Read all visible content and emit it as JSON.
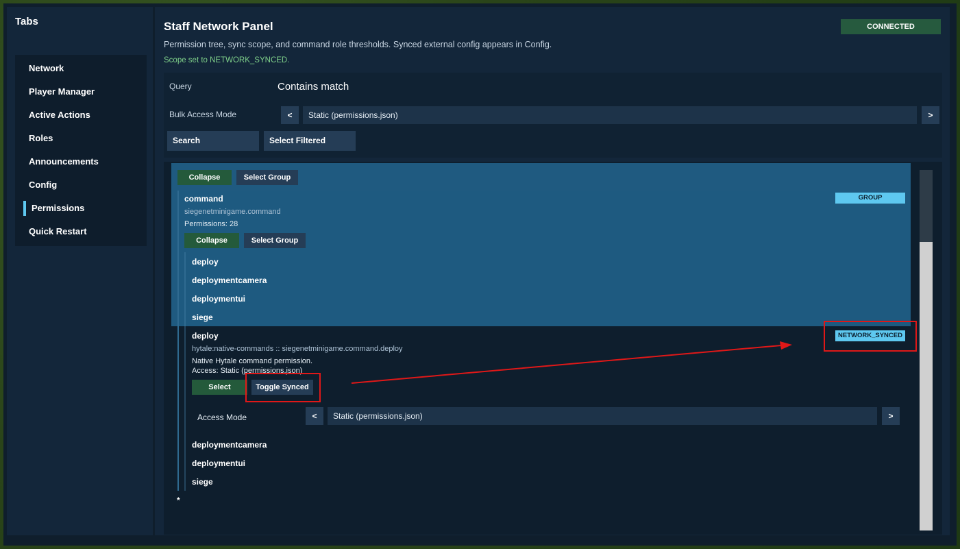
{
  "sidebar": {
    "title": "Tabs",
    "items": [
      {
        "label": "Network"
      },
      {
        "label": "Player Manager"
      },
      {
        "label": "Active Actions"
      },
      {
        "label": "Roles"
      },
      {
        "label": "Announcements"
      },
      {
        "label": "Config"
      },
      {
        "label": "Permissions",
        "active": true
      },
      {
        "label": "Quick Restart"
      }
    ]
  },
  "header": {
    "title": "Staff Network Panel",
    "status": "CONNECTED",
    "description": "Permission tree, sync scope, and command role thresholds. Synced external config appears in Config.",
    "scope_message": "Scope set to NETWORK_SYNCED."
  },
  "filters": {
    "query_label": "Query",
    "query_value": "Contains match",
    "bulk_label": "Bulk Access Mode",
    "prev": "<",
    "next": ">",
    "bulk_value": "Static (permissions.json)",
    "search_button": "Search",
    "select_filtered_button": "Select Filtered"
  },
  "tree": {
    "top_collapse": "Collapse",
    "top_select_group": "Select Group",
    "group": {
      "name": "command",
      "path": "siegenetminigame.command",
      "count": "Permissions: 28",
      "tag": "GROUP",
      "collapse": "Collapse",
      "select_group": "Select Group",
      "children": [
        "deploy",
        "deploymentcamera",
        "deploymentui",
        "siege"
      ]
    },
    "detail": {
      "name": "deploy",
      "full_path": "hytale:native-commands :: siegenetminigame.command.deploy",
      "description": "Native Hytale command permission.",
      "access": "Access: Static (permissions.json)",
      "tag": "NETWORK_SYNCED",
      "select": "Select",
      "toggle_synced": "Toggle Synced",
      "access_mode_label": "Access Mode",
      "access_mode_value": "Static (permissions.json)",
      "prev": "<",
      "next": ">"
    },
    "after_items": [
      "deploymentcamera",
      "deploymentui",
      "siege"
    ],
    "wildcard": "*"
  },
  "colors": {
    "accent": "#5ec8f0",
    "selected": "#1f5a80",
    "green": "#245a3b",
    "annotation": "#e01818"
  }
}
